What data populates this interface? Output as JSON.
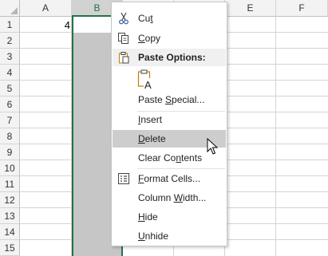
{
  "columns": [
    "A",
    "B",
    "C",
    "D",
    "E",
    "F"
  ],
  "rows": [
    "1",
    "2",
    "3",
    "4",
    "5",
    "6",
    "7",
    "8",
    "9",
    "10",
    "11",
    "12",
    "13",
    "14",
    "15"
  ],
  "cells": {
    "A1": "4"
  },
  "accent_color": "#217346",
  "context_menu": {
    "cut": "Cut",
    "copy": "Copy",
    "paste_options": "Paste Options:",
    "paste_special": "Paste Special...",
    "insert": "Insert",
    "delete": "Delete",
    "clear_contents": "Clear Contents",
    "format_cells": "Format Cells...",
    "column_width": "Column Width...",
    "hide": "Hide",
    "unhide": "Unhide"
  },
  "icons": {
    "cut": "scissors-icon",
    "copy": "copy-icon",
    "paste_options": "clipboard-icon",
    "paste_values": "paste-text-icon",
    "format_cells": "format-cells-icon",
    "cursor": "mouse-pointer-icon"
  }
}
